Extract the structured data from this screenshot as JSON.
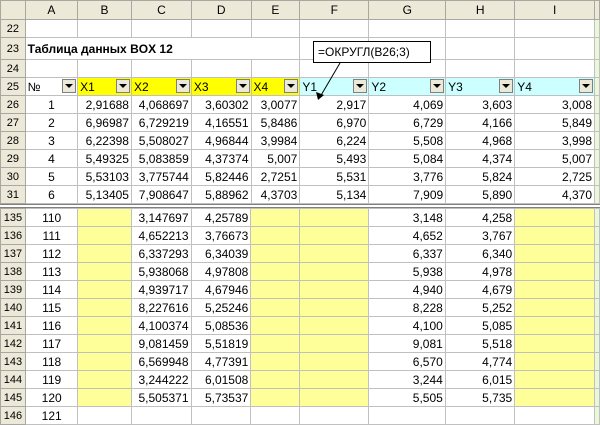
{
  "columns": [
    "A",
    "B",
    "C",
    "D",
    "E",
    "F",
    "G",
    "H",
    "I"
  ],
  "title_row": {
    "row": "23",
    "text": "Таблица данных BOX 12"
  },
  "blank_rows": [
    "22",
    "24"
  ],
  "header_row": {
    "row": "25",
    "labels": [
      "№",
      "X1",
      "X2",
      "X3",
      "X4",
      "Y1",
      "Y2",
      "Y3",
      "Y4"
    ]
  },
  "callout": "=ОКРУГЛ(B26;3)",
  "top_rows": [
    {
      "row": "26",
      "cells": [
        "1",
        "2,91688",
        "4,068697",
        "3,60302",
        "3,0077",
        "2,917",
        "4,069",
        "3,603",
        "3,008"
      ]
    },
    {
      "row": "27",
      "cells": [
        "2",
        "6,96987",
        "6,729219",
        "4,16551",
        "5,8486",
        "6,970",
        "6,729",
        "4,166",
        "5,849"
      ]
    },
    {
      "row": "28",
      "cells": [
        "3",
        "6,22398",
        "5,508027",
        "4,96844",
        "3,9984",
        "6,224",
        "5,508",
        "4,968",
        "3,998"
      ]
    },
    {
      "row": "29",
      "cells": [
        "4",
        "5,49325",
        "5,083859",
        "4,37374",
        "5,007",
        "5,493",
        "5,084",
        "4,374",
        "5,007"
      ]
    },
    {
      "row": "30",
      "cells": [
        "5",
        "5,53103",
        "3,775744",
        "5,82446",
        "2,7251",
        "5,531",
        "3,776",
        "5,824",
        "2,725"
      ]
    },
    {
      "row": "31",
      "cells": [
        "6",
        "5,13405",
        "7,908647",
        "5,88962",
        "4,3703",
        "5,134",
        "7,909",
        "5,890",
        "4,370"
      ]
    }
  ],
  "bottom_rows": [
    {
      "row": "135",
      "cells": [
        "110",
        "",
        "3,147697",
        "4,25789",
        "",
        "",
        "3,148",
        "4,258",
        ""
      ]
    },
    {
      "row": "136",
      "cells": [
        "111",
        "",
        "4,652213",
        "3,76673",
        "",
        "",
        "4,652",
        "3,767",
        ""
      ]
    },
    {
      "row": "137",
      "cells": [
        "112",
        "",
        "6,337293",
        "6,34039",
        "",
        "",
        "6,337",
        "6,340",
        ""
      ]
    },
    {
      "row": "138",
      "cells": [
        "113",
        "",
        "5,938068",
        "4,97808",
        "",
        "",
        "5,938",
        "4,978",
        ""
      ]
    },
    {
      "row": "139",
      "cells": [
        "114",
        "",
        "4,939717",
        "4,67946",
        "",
        "",
        "4,940",
        "4,679",
        ""
      ]
    },
    {
      "row": "140",
      "cells": [
        "115",
        "",
        "8,227616",
        "5,25246",
        "",
        "",
        "8,228",
        "5,252",
        ""
      ]
    },
    {
      "row": "141",
      "cells": [
        "116",
        "",
        "4,100374",
        "5,08536",
        "",
        "",
        "4,100",
        "5,085",
        ""
      ]
    },
    {
      "row": "142",
      "cells": [
        "117",
        "",
        "9,081459",
        "5,51819",
        "",
        "",
        "9,081",
        "5,518",
        ""
      ]
    },
    {
      "row": "143",
      "cells": [
        "118",
        "",
        "6,569948",
        "4,77391",
        "",
        "",
        "6,570",
        "4,774",
        ""
      ]
    },
    {
      "row": "144",
      "cells": [
        "119",
        "",
        "3,244222",
        "6,01508",
        "",
        "",
        "3,244",
        "6,015",
        ""
      ]
    },
    {
      "row": "145",
      "cells": [
        "120",
        "",
        "5,505371",
        "5,73537",
        "",
        "",
        "5,505",
        "5,735",
        ""
      ]
    },
    {
      "row": "146",
      "cells": [
        "121",
        "",
        "",
        "",
        "",
        "",
        "",
        "",
        ""
      ]
    }
  ],
  "colors": {
    "yellow_header": "#ffff00",
    "cyan_header": "#ccffff",
    "yellow_fill": "#ffff99",
    "header_gray": "#ece9d8"
  }
}
